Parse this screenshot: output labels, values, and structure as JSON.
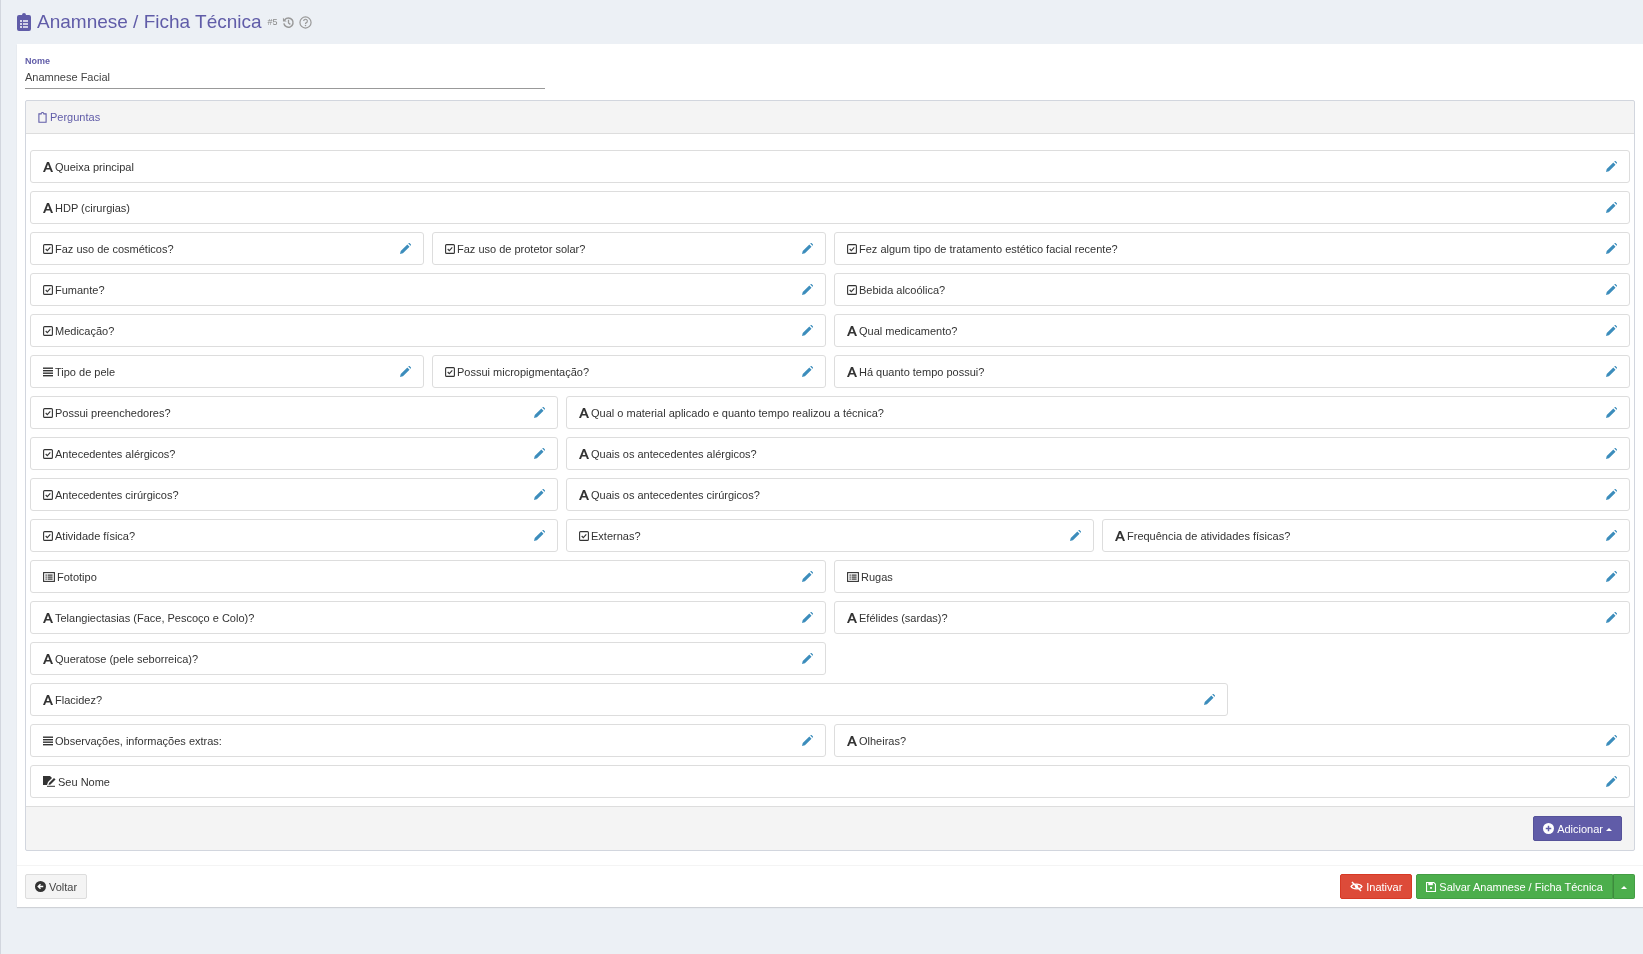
{
  "header": {
    "title": "Anamnese / Ficha Técnica",
    "badge": "#5"
  },
  "name_field": {
    "label": "Nome",
    "value": "Anamnese Facial"
  },
  "questions_panel": {
    "title": "Perguntas",
    "rows": [
      [
        {
          "label": "Queixa principal",
          "kind": "text"
        }
      ],
      [
        {
          "label": "HDP (cirurgias)",
          "kind": "text"
        }
      ],
      [
        {
          "label": "Faz uso de cosméticos?",
          "kind": "checkbox"
        },
        {
          "label": "Faz uso de protetor solar?",
          "kind": "checkbox"
        },
        {
          "label": "Fez algum tipo de tratamento estético facial recente?",
          "kind": "checkbox"
        }
      ],
      [
        {
          "label": "Fumante?",
          "kind": "checkbox"
        },
        {
          "label": "Bebida alcoólica?",
          "kind": "checkbox"
        }
      ],
      [
        {
          "label": "Medicação?",
          "kind": "checkbox"
        },
        {
          "label": "Qual medicamento?",
          "kind": "text"
        }
      ],
      [
        {
          "label": "Tipo de pele",
          "kind": "list"
        },
        {
          "label": "Possui micropigmentação?",
          "kind": "checkbox"
        },
        {
          "label": "Há quanto tempo possui?",
          "kind": "text"
        }
      ],
      [
        {
          "label": "Possui preenchedores?",
          "kind": "checkbox"
        },
        {
          "label": "Qual o material aplicado e quanto tempo realizou a técnica?",
          "kind": "text"
        }
      ],
      [
        {
          "label": "Antecedentes alérgicos?",
          "kind": "checkbox"
        },
        {
          "label": "Quais os antecedentes alérgicos?",
          "kind": "text"
        }
      ],
      [
        {
          "label": "Antecedentes cirúrgicos?",
          "kind": "checkbox"
        },
        {
          "label": "Quais os antecedentes cirúrgicos?",
          "kind": "text"
        }
      ],
      [
        {
          "label": "Atividade física?",
          "kind": "checkbox"
        },
        {
          "label": "Externas?",
          "kind": "checkbox"
        },
        {
          "label": "Frequência de atividades físicas?",
          "kind": "text"
        }
      ],
      [
        {
          "label": "Fototipo",
          "kind": "table"
        },
        {
          "label": "Rugas",
          "kind": "table"
        }
      ],
      [
        {
          "label": "Telangiectasias (Face, Pescoço e Colo)?",
          "kind": "text"
        },
        {
          "label": "Efélides (sardas)?",
          "kind": "text"
        }
      ],
      [
        {
          "label": "Queratose (pele seborreica)?",
          "kind": "text"
        }
      ],
      [
        {
          "label": "Flacidez?",
          "kind": "text"
        }
      ],
      [
        {
          "label": "Observações, informações extras:",
          "kind": "list"
        },
        {
          "label": "Olheiras?",
          "kind": "text"
        }
      ],
      [
        {
          "label": "Seu Nome",
          "kind": "signature"
        }
      ]
    ],
    "add_button": "Adicionar"
  },
  "footer": {
    "back_button": "Voltar",
    "deactivate_button": "Inativar",
    "save_button": "Salvar Anamnese / Ficha Técnica"
  }
}
